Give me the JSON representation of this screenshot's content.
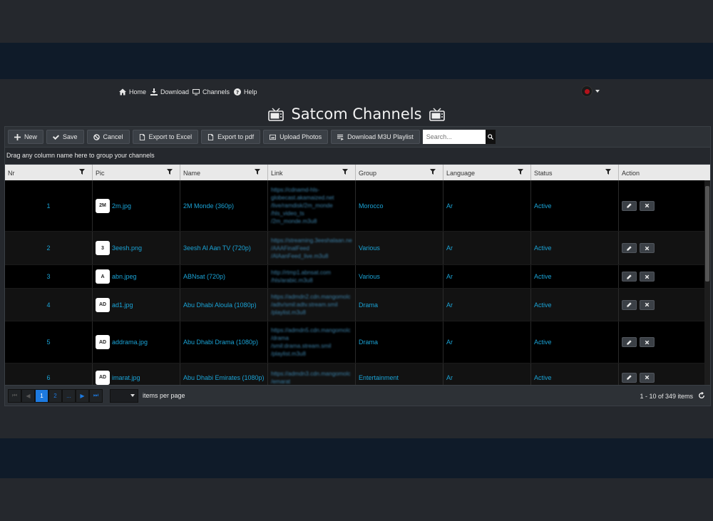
{
  "nav": {
    "home": "Home",
    "download": "Download",
    "channels": "Channels",
    "help": "Help"
  },
  "page_title": "Satcom Channels",
  "toolbar": {
    "new": "New",
    "save": "Save",
    "cancel": "Cancel",
    "export_excel": "Export to Excel",
    "export_pdf": "Export to pdf",
    "upload_photos": "Upload Photos",
    "download_m3u": "Download M3U Playlist",
    "search_placeholder": "Search..."
  },
  "group_hint": "Drag any column name here to group your channels",
  "columns": [
    "Nr",
    "Pic",
    "Name",
    "Link",
    "Group",
    "Language",
    "Status",
    "Action"
  ],
  "rows": [
    {
      "nr": "1",
      "pic": "2m.jpg",
      "thumb": "2M",
      "name": "2M Monde (360p)",
      "link": [
        "https://cdnamd-hls-",
        "globecast.akamaized.net",
        "/live/ramdisk/2m_monde",
        "/hls_video_ts",
        "/2m_monde.m3u8"
      ],
      "group": "Morocco",
      "language": "Ar",
      "status": "Active"
    },
    {
      "nr": "2",
      "pic": "3eesh.png",
      "thumb": "3",
      "name": "3eesh Al Aan TV (720p)",
      "link": [
        "https://streaming.3eeshalaan.ne",
        "/AAAFinalFeed",
        "/AlAanFeed_live.m3u8"
      ],
      "group": "Various",
      "language": "Ar",
      "status": "Active"
    },
    {
      "nr": "3",
      "pic": "abn.jpeg",
      "thumb": "A",
      "name": "ABNsat (720p)",
      "link": [
        "http://rtmp1.abnsat.com",
        "/hls/arabic.m3u8"
      ],
      "group": "Various",
      "language": "Ar",
      "status": "Active"
    },
    {
      "nr": "4",
      "pic": "ad1.jpg",
      "thumb": "AD",
      "name": "Abu Dhabi Aloula (1080p)",
      "link": [
        "https://admdn2.cdn.mangomolc",
        "/adtv/smil:adtv.stream.smil",
        "/playlist.m3u8"
      ],
      "group": "Drama",
      "language": "Ar",
      "status": "Active"
    },
    {
      "nr": "5",
      "pic": "addrama.jpg",
      "thumb": "AD",
      "name": "Abu Dhabi Drama (1080p)",
      "link": [
        "https://admdn5.cdn.mangomolc",
        "/drama",
        "/smil:drama.stream.smil",
        "/playlist.m3u8"
      ],
      "group": "Drama",
      "language": "Ar",
      "status": "Active"
    },
    {
      "nr": "6",
      "pic": "imarat.jpg",
      "thumb": "AD",
      "name": "Abu Dhabi Emirates (1080p)",
      "link": [
        "https://admdn3.cdn.mangomolc",
        "/emarat"
      ],
      "group": "Entertainment",
      "language": "Ar",
      "status": "Active"
    }
  ],
  "pager": {
    "first": "⏮",
    "prev": "◀",
    "page1": "1",
    "page2": "2",
    "more": "...",
    "next": "▶",
    "last": "⏭",
    "items_per_page": "items per page",
    "count": "1 - 10 of 349 items"
  }
}
